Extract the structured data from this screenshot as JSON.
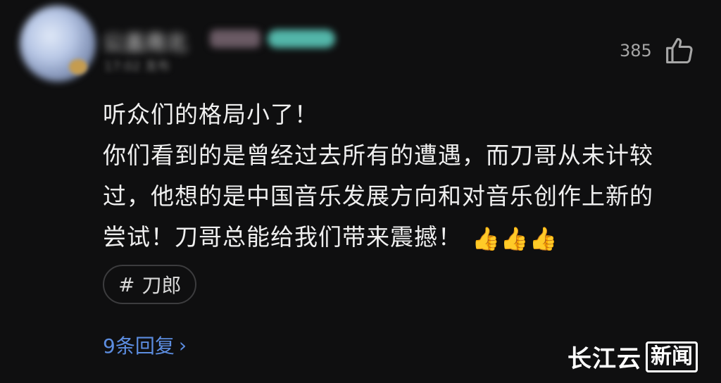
{
  "comment_meta": {
    "user_name": "公盖南北",
    "post_time": "17:02 发布",
    "like_count": "385",
    "like_icon": "thumbs-up-outline-icon"
  },
  "comment": {
    "lines": [
      "听众们的格局小了！",
      "你们看到的是曾经过去所有的遭遇，而刀哥从未计较",
      "过，他想的是中国音乐发展方向和对音乐创作上新的",
      "尝试！刀哥总能给我们带来震撼！"
    ],
    "emojis": [
      "👍",
      "👍",
      "👍"
    ]
  },
  "hashtag": {
    "symbol": "#",
    "label": "刀郎"
  },
  "replies": {
    "label": "9条回复",
    "chevron": "›"
  },
  "watermark": {
    "brand": "长江云",
    "badge": "新闻"
  },
  "colors": {
    "background": "#0f0f10",
    "reply_link": "#5c8de0",
    "text": "#efefef"
  }
}
